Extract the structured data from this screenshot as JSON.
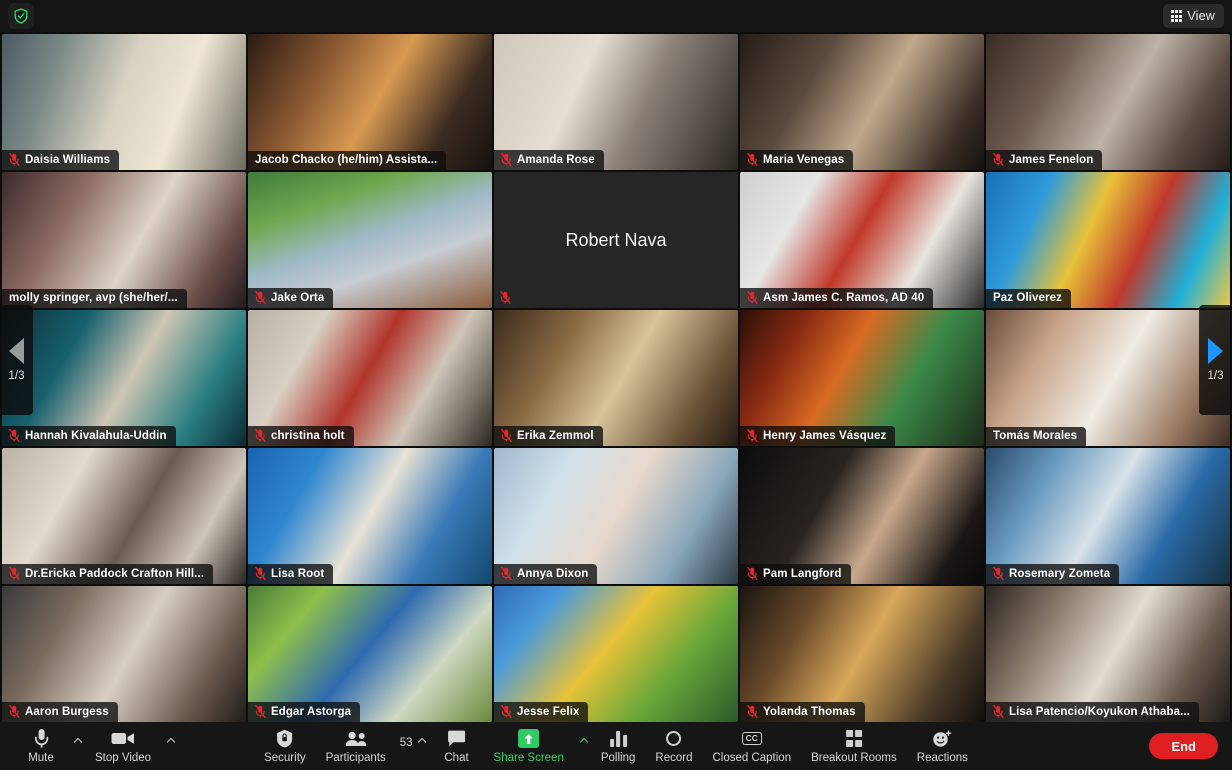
{
  "topbar": {
    "shield_icon": "shield-icon",
    "view_label": "View",
    "view_icon": "grid-view-icon"
  },
  "page_nav": {
    "left_indicator": "1/3",
    "right_indicator": "1/3",
    "left_icon": "arrow-left-icon",
    "right_icon": "arrow-right-icon"
  },
  "gallery": {
    "rows": 5,
    "cols": 5,
    "active_speaker": "Tomás Morales",
    "tiles": [
      {
        "name": "Daisia Williams",
        "muted": true,
        "video_off": false,
        "speaking": false,
        "bg": "linear-gradient(110deg,#4a5a62 0%,#7c8a86 22%,#d8d2c2 48%,#efe6d4 70%,#6b6a5e 100%)"
      },
      {
        "name": "Jacob Chacko (he/him) Assista...",
        "muted": false,
        "video_off": false,
        "speaking": false,
        "bg": "linear-gradient(120deg,#2a1a12 0%,#8d5a33 30%,#d89a52 52%,#3b2b22 78%,#16110e 100%)"
      },
      {
        "name": "Amanda Rose",
        "muted": true,
        "video_off": false,
        "speaking": false,
        "bg": "linear-gradient(115deg,#cfc6ba 0%,#e6ded2 35%,#8a8078 60%,#2b2622 100%)"
      },
      {
        "name": "Maria Venegas",
        "muted": true,
        "video_off": false,
        "speaking": false,
        "bg": "linear-gradient(120deg,#241c18 0%,#5b4a3c 30%,#c0a88c 55%,#3a2e26 85%,#15110f 100%)"
      },
      {
        "name": "James Fenelon",
        "muted": true,
        "video_off": false,
        "speaking": false,
        "bg": "linear-gradient(120deg,#3a2b26 0%,#6e5a4e 28%,#bcb3a6 55%,#5a4a42 80%,#241c18 100%)"
      },
      {
        "name": "molly springer, avp (she/her/...",
        "muted": false,
        "video_off": false,
        "speaking": false,
        "bg": "linear-gradient(120deg,#3c2a2c 0%,#8c6b62 28%,#ded4c8 55%,#6b4e4a 82%,#241a1c 100%)"
      },
      {
        "name": "Jake Orta",
        "muted": true,
        "video_off": false,
        "speaking": false,
        "bg": "linear-gradient(160deg,#3f7a3a 0%,#6fa84f 26%,#9fb9c8 48%,#c8ccd2 66%,#8a5a3a 100%)"
      },
      {
        "name": "Robert Nava",
        "muted": true,
        "video_off": true,
        "speaking": false,
        "bg": "#262626"
      },
      {
        "name": "Asm James C. Ramos, AD 40",
        "muted": true,
        "video_off": false,
        "speaking": false,
        "bg": "linear-gradient(120deg,#cfcfcf 0%,#e6e6e6 25%,#c0392b 48%,#e8e4de 72%,#2a2a2a 100%)"
      },
      {
        "name": "Paz Oliverez",
        "muted": false,
        "video_off": false,
        "speaking": false,
        "bg": "linear-gradient(115deg,#1a6fb5 0%,#2f9ada 22%,#e8c23a 42%,#c0392b 62%,#1fb0d8 82%,#f2c744 100%)"
      },
      {
        "name": "Hannah Kivalahula-Uddin",
        "muted": true,
        "video_off": false,
        "speaking": false,
        "bg": "linear-gradient(120deg,#0d2b36 0%,#16606e 28%,#cfc6b4 52%,#2a7f82 78%,#0b2a33 100%)"
      },
      {
        "name": "christina holt",
        "muted": true,
        "video_off": false,
        "speaking": false,
        "bg": "linear-gradient(120deg,#b8b0a2 0%,#d8d0c2 25%,#b0342c 48%,#cfc6b8 70%,#2a2620 100%)"
      },
      {
        "name": "Erika Zemmol",
        "muted": true,
        "video_off": false,
        "speaking": false,
        "bg": "linear-gradient(120deg,#3a2a1c 0%,#8a6a44 28%,#d8c49a 52%,#6a5236 80%,#241a12 100%)"
      },
      {
        "name": "Henry James Vásquez",
        "muted": true,
        "video_off": false,
        "speaking": false,
        "bg": "linear-gradient(120deg,#2a0f08 0%,#8a2a12 22%,#d86a22 42%,#3c8a4a 66%,#1c2a18 100%)"
      },
      {
        "name": "Tomás Morales",
        "muted": false,
        "video_off": false,
        "speaking": true,
        "bg": "linear-gradient(120deg,#6a4a3a 0%,#c8a48a 25%,#f0ece4 52%,#9a7a62 80%,#3a2a22 100%)"
      },
      {
        "name": "Dr.Ericka Paddock Crafton Hill...",
        "muted": true,
        "video_off": false,
        "speaking": false,
        "bg": "linear-gradient(120deg,#bab2a6 0%,#e2dad0 28%,#6a5a52 55%,#cfc6ba 78%,#2a2420 100%)"
      },
      {
        "name": "Lisa Root",
        "muted": true,
        "video_off": false,
        "speaking": false,
        "bg": "linear-gradient(120deg,#1a64b0 0%,#2f86cf 24%,#e8e2d6 50%,#3a7ab8 74%,#12486f 100%)"
      },
      {
        "name": "Annya Dixon",
        "muted": true,
        "video_off": false,
        "speaking": false,
        "bg": "linear-gradient(120deg,#9fb8cc 0%,#cfe0ea 25%,#e8d8cc 50%,#8aa8bc 76%,#2a3a44 100%)"
      },
      {
        "name": "Pam Langford",
        "muted": true,
        "video_off": false,
        "speaking": false,
        "bg": "linear-gradient(120deg,#0c0c0c 0%,#2a2420 35%,#c8a88c 58%,#1a1614 85%,#0a0a0a 100%)"
      },
      {
        "name": "Rosemary Zometa",
        "muted": true,
        "video_off": false,
        "speaking": false,
        "bg": "linear-gradient(120deg,#2a4a6a 0%,#6a9ac0 24%,#d8e2e8 48%,#2a6aa8 72%,#16303f 100%)"
      },
      {
        "name": "Aaron Burgess",
        "muted": true,
        "video_off": false,
        "speaking": false,
        "bg": "linear-gradient(120deg,#3a3a3a 0%,#7a6a5e 25%,#d8cfc4 52%,#6a5a4e 80%,#201c18 100%)"
      },
      {
        "name": "Edgar Astorga",
        "muted": true,
        "video_off": false,
        "speaking": false,
        "bg": "linear-gradient(130deg,#4a7a3a 0%,#8fbf4a 22%,#2f6ab0 48%,#cfd8c2 72%,#6a8a3a 100%)"
      },
      {
        "name": "Jesse Felix",
        "muted": true,
        "video_off": false,
        "speaking": false,
        "bg": "linear-gradient(130deg,#2f6ab8 0%,#4a9ada 20%,#e8c23a 46%,#6aa83a 70%,#2a5a2a 100%)"
      },
      {
        "name": "Yolanda Thomas",
        "muted": true,
        "video_off": false,
        "speaking": false,
        "bg": "linear-gradient(120deg,#1a1410 0%,#6a4a2a 26%,#d8a85a 50%,#4a3a28 80%,#120e0c 100%)"
      },
      {
        "name": "Lisa Patencio/Koyukon Athaba...",
        "muted": true,
        "video_off": false,
        "speaking": false,
        "bg": "linear-gradient(120deg,#2a2420 0%,#8a7a6a 26%,#e2dcd2 52%,#6a5a4e 78%,#1c1816 100%)"
      }
    ]
  },
  "toolbar": {
    "mute": {
      "label": "Mute",
      "icon": "microphone-icon",
      "caret": true
    },
    "stop_video": {
      "label": "Stop Video",
      "icon": "camera-icon",
      "caret": true
    },
    "security": {
      "label": "Security",
      "icon": "shield-icon"
    },
    "participants": {
      "label": "Participants",
      "icon": "people-icon",
      "count": "53",
      "caret": true
    },
    "chat": {
      "label": "Chat",
      "icon": "chat-bubble-icon"
    },
    "share_screen": {
      "label": "Share Screen",
      "icon": "share-screen-icon",
      "caret": true,
      "active": true
    },
    "polling": {
      "label": "Polling",
      "icon": "bar-chart-icon"
    },
    "record": {
      "label": "Record",
      "icon": "record-circle-icon"
    },
    "closed_caption": {
      "label": "Closed Caption",
      "icon": "cc-icon"
    },
    "breakout_rooms": {
      "label": "Breakout Rooms",
      "icon": "grid-squares-icon"
    },
    "reactions": {
      "label": "Reactions",
      "icon": "smiley-plus-icon"
    },
    "end": {
      "label": "End"
    }
  },
  "colors": {
    "accent_green": "#38d06c",
    "active_speaker_border": "#b9d93c",
    "end_red": "#e02020",
    "nav_blue": "#1d97ff",
    "mute_red": "#e8252a"
  }
}
